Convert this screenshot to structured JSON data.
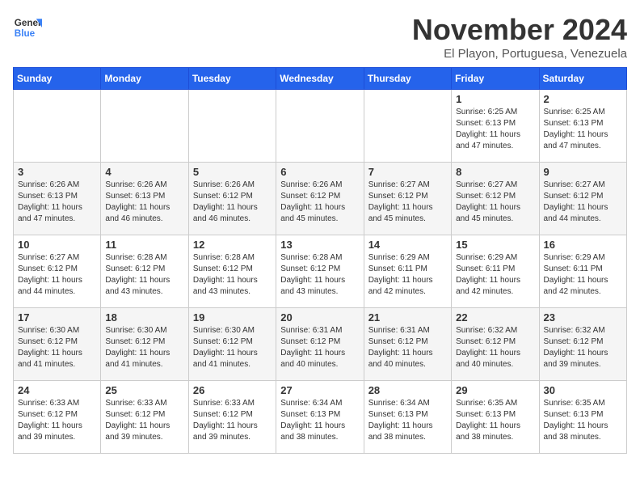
{
  "header": {
    "logo_general": "General",
    "logo_blue": "Blue",
    "month_title": "November 2024",
    "location": "El Playon, Portuguesa, Venezuela"
  },
  "days_of_week": [
    "Sunday",
    "Monday",
    "Tuesday",
    "Wednesday",
    "Thursday",
    "Friday",
    "Saturday"
  ],
  "weeks": [
    [
      {
        "day": "",
        "text": ""
      },
      {
        "day": "",
        "text": ""
      },
      {
        "day": "",
        "text": ""
      },
      {
        "day": "",
        "text": ""
      },
      {
        "day": "",
        "text": ""
      },
      {
        "day": "1",
        "text": "Sunrise: 6:25 AM\nSunset: 6:13 PM\nDaylight: 11 hours and 47 minutes."
      },
      {
        "day": "2",
        "text": "Sunrise: 6:25 AM\nSunset: 6:13 PM\nDaylight: 11 hours and 47 minutes."
      }
    ],
    [
      {
        "day": "3",
        "text": "Sunrise: 6:26 AM\nSunset: 6:13 PM\nDaylight: 11 hours and 47 minutes."
      },
      {
        "day": "4",
        "text": "Sunrise: 6:26 AM\nSunset: 6:13 PM\nDaylight: 11 hours and 46 minutes."
      },
      {
        "day": "5",
        "text": "Sunrise: 6:26 AM\nSunset: 6:12 PM\nDaylight: 11 hours and 46 minutes."
      },
      {
        "day": "6",
        "text": "Sunrise: 6:26 AM\nSunset: 6:12 PM\nDaylight: 11 hours and 45 minutes."
      },
      {
        "day": "7",
        "text": "Sunrise: 6:27 AM\nSunset: 6:12 PM\nDaylight: 11 hours and 45 minutes."
      },
      {
        "day": "8",
        "text": "Sunrise: 6:27 AM\nSunset: 6:12 PM\nDaylight: 11 hours and 45 minutes."
      },
      {
        "day": "9",
        "text": "Sunrise: 6:27 AM\nSunset: 6:12 PM\nDaylight: 11 hours and 44 minutes."
      }
    ],
    [
      {
        "day": "10",
        "text": "Sunrise: 6:27 AM\nSunset: 6:12 PM\nDaylight: 11 hours and 44 minutes."
      },
      {
        "day": "11",
        "text": "Sunrise: 6:28 AM\nSunset: 6:12 PM\nDaylight: 11 hours and 43 minutes."
      },
      {
        "day": "12",
        "text": "Sunrise: 6:28 AM\nSunset: 6:12 PM\nDaylight: 11 hours and 43 minutes."
      },
      {
        "day": "13",
        "text": "Sunrise: 6:28 AM\nSunset: 6:12 PM\nDaylight: 11 hours and 43 minutes."
      },
      {
        "day": "14",
        "text": "Sunrise: 6:29 AM\nSunset: 6:11 PM\nDaylight: 11 hours and 42 minutes."
      },
      {
        "day": "15",
        "text": "Sunrise: 6:29 AM\nSunset: 6:11 PM\nDaylight: 11 hours and 42 minutes."
      },
      {
        "day": "16",
        "text": "Sunrise: 6:29 AM\nSunset: 6:11 PM\nDaylight: 11 hours and 42 minutes."
      }
    ],
    [
      {
        "day": "17",
        "text": "Sunrise: 6:30 AM\nSunset: 6:12 PM\nDaylight: 11 hours and 41 minutes."
      },
      {
        "day": "18",
        "text": "Sunrise: 6:30 AM\nSunset: 6:12 PM\nDaylight: 11 hours and 41 minutes."
      },
      {
        "day": "19",
        "text": "Sunrise: 6:30 AM\nSunset: 6:12 PM\nDaylight: 11 hours and 41 minutes."
      },
      {
        "day": "20",
        "text": "Sunrise: 6:31 AM\nSunset: 6:12 PM\nDaylight: 11 hours and 40 minutes."
      },
      {
        "day": "21",
        "text": "Sunrise: 6:31 AM\nSunset: 6:12 PM\nDaylight: 11 hours and 40 minutes."
      },
      {
        "day": "22",
        "text": "Sunrise: 6:32 AM\nSunset: 6:12 PM\nDaylight: 11 hours and 40 minutes."
      },
      {
        "day": "23",
        "text": "Sunrise: 6:32 AM\nSunset: 6:12 PM\nDaylight: 11 hours and 39 minutes."
      }
    ],
    [
      {
        "day": "24",
        "text": "Sunrise: 6:33 AM\nSunset: 6:12 PM\nDaylight: 11 hours and 39 minutes."
      },
      {
        "day": "25",
        "text": "Sunrise: 6:33 AM\nSunset: 6:12 PM\nDaylight: 11 hours and 39 minutes."
      },
      {
        "day": "26",
        "text": "Sunrise: 6:33 AM\nSunset: 6:12 PM\nDaylight: 11 hours and 39 minutes."
      },
      {
        "day": "27",
        "text": "Sunrise: 6:34 AM\nSunset: 6:13 PM\nDaylight: 11 hours and 38 minutes."
      },
      {
        "day": "28",
        "text": "Sunrise: 6:34 AM\nSunset: 6:13 PM\nDaylight: 11 hours and 38 minutes."
      },
      {
        "day": "29",
        "text": "Sunrise: 6:35 AM\nSunset: 6:13 PM\nDaylight: 11 hours and 38 minutes."
      },
      {
        "day": "30",
        "text": "Sunrise: 6:35 AM\nSunset: 6:13 PM\nDaylight: 11 hours and 38 minutes."
      }
    ]
  ]
}
